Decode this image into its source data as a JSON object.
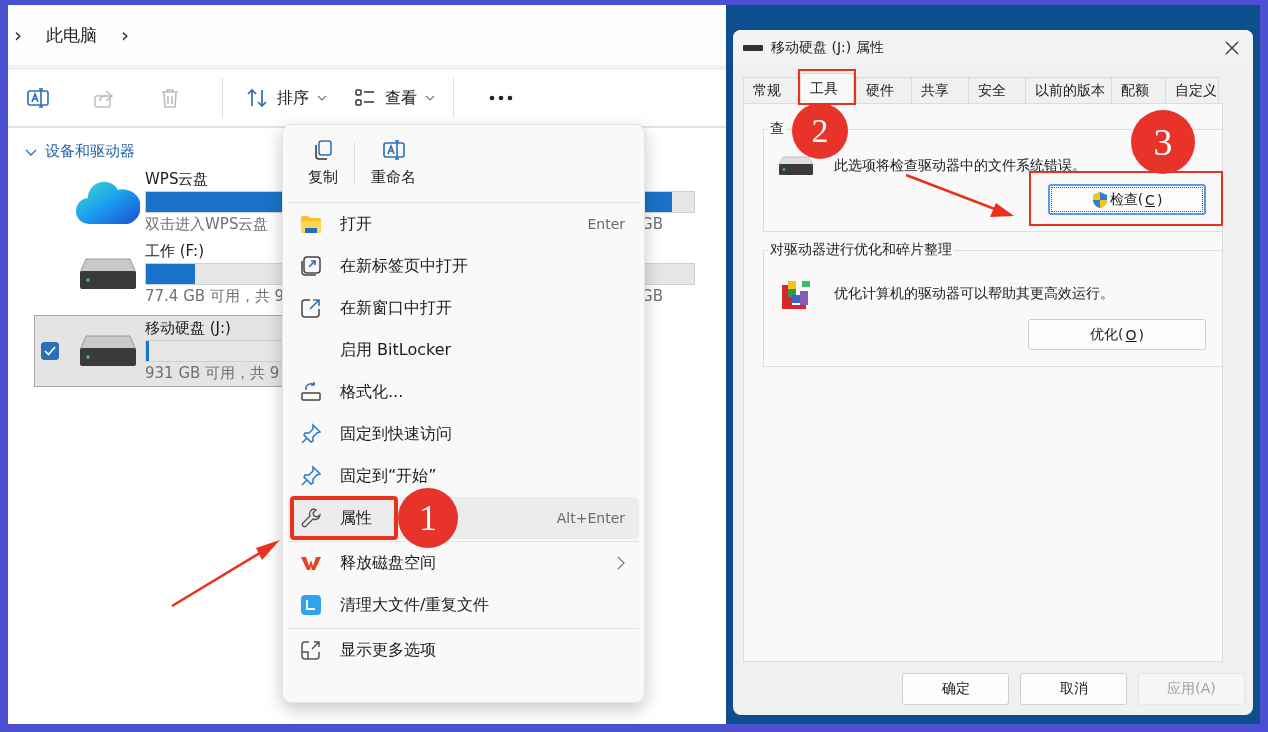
{
  "explorer": {
    "breadcrumb": [
      {
        "kind": "chevron",
        "label": "›"
      },
      {
        "kind": "text",
        "label": "此电脑"
      },
      {
        "kind": "chevron",
        "label": "›"
      }
    ],
    "toolbar": [
      {
        "kind": "rename",
        "disabled": false
      },
      {
        "kind": "share",
        "disabled": true
      },
      {
        "kind": "delete",
        "disabled": true
      },
      {
        "kind": "divider"
      },
      {
        "kind": "sort",
        "label": "排序"
      },
      {
        "kind": "view",
        "label": "查看"
      },
      {
        "kind": "divider"
      },
      {
        "kind": "more"
      }
    ],
    "section": {
      "title": "设备和驱动器",
      "expanded": true
    },
    "drives": [
      {
        "kind": "cloud",
        "name": "WPS云盘",
        "caption": "双击进入WPS云盘",
        "level": 0.96,
        "tail": "GB",
        "selected": false,
        "checked": false
      },
      {
        "kind": "disk",
        "name": "工作 (F:)",
        "caption": "77.4 GB 可用，共 9",
        "level": 0.09,
        "tail": "GB",
        "selected": false,
        "checked": false
      },
      {
        "kind": "disk",
        "name": "移动硬盘 (J:)",
        "caption": "931 GB 可用，共 9",
        "level": 0.01,
        "selected": true,
        "checked": true
      }
    ]
  },
  "context_menu": {
    "quick": [
      {
        "kind": "copy",
        "label": "复制"
      },
      {
        "kind": "rename",
        "label": "重命名"
      }
    ],
    "sections": [
      [
        {
          "kind": "open",
          "label": "打开",
          "shortcut": "Enter",
          "selected": false
        },
        {
          "kind": "new_tab",
          "label": "在新标签页中打开",
          "selected": false
        },
        {
          "kind": "new_window",
          "label": "在新窗口中打开",
          "selected": false
        },
        {
          "kind": "plain",
          "label": "启用 BitLocker",
          "selected": false
        },
        {
          "kind": "format",
          "label": "格式化...",
          "selected": false
        },
        {
          "kind": "pin",
          "label": "固定到快速访问",
          "selected": false
        },
        {
          "kind": "pin",
          "label": "固定到“开始”",
          "selected": false
        },
        {
          "kind": "properties",
          "label": "属性",
          "shortcut": "Alt+Enter",
          "selected": true,
          "annotation": {
            "badge": "1",
            "arrow": true
          }
        }
      ],
      [
        {
          "kind": "wps",
          "label": "释放磁盘空间",
          "submenu": true,
          "selected": false
        },
        {
          "kind": "cleaner",
          "label": "清理大文件/重复文件",
          "selected": false
        }
      ],
      [
        {
          "kind": "more_options",
          "label": "显示更多选项",
          "selected": false
        }
      ]
    ]
  },
  "dialog": {
    "title": "移动硬盘 (J:) 属性",
    "tabs": [
      {
        "label": "常规",
        "selected": false
      },
      {
        "label": "工具",
        "selected": true,
        "annotation": {
          "badge": "2"
        }
      },
      {
        "label": "硬件",
        "selected": false
      },
      {
        "label": "共享",
        "selected": false
      },
      {
        "label": "安全",
        "selected": false
      },
      {
        "label": "以前的版本",
        "selected": false
      },
      {
        "label": "配额",
        "selected": false
      },
      {
        "label": "自定义",
        "selected": false
      }
    ],
    "groups": [
      {
        "kind": "check",
        "title": "查",
        "text": "此选项将检查驱动器中的文件系统错误。",
        "button": {
          "label": "检查(C)",
          "shield": true,
          "focused": true,
          "annotation": {
            "badge": "3",
            "arrow": true
          }
        }
      },
      {
        "kind": "defrag",
        "title": "对驱动器进行优化和碎片整理",
        "text": "优化计算机的驱动器可以帮助其更高效运行。",
        "button": {
          "label": "优化(O)",
          "shield": false,
          "focused": false
        }
      }
    ],
    "buttons": [
      {
        "label": "确定",
        "disabled": false
      },
      {
        "label": "取消",
        "disabled": false
      },
      {
        "label": "应用(A)",
        "disabled": true
      }
    ]
  }
}
